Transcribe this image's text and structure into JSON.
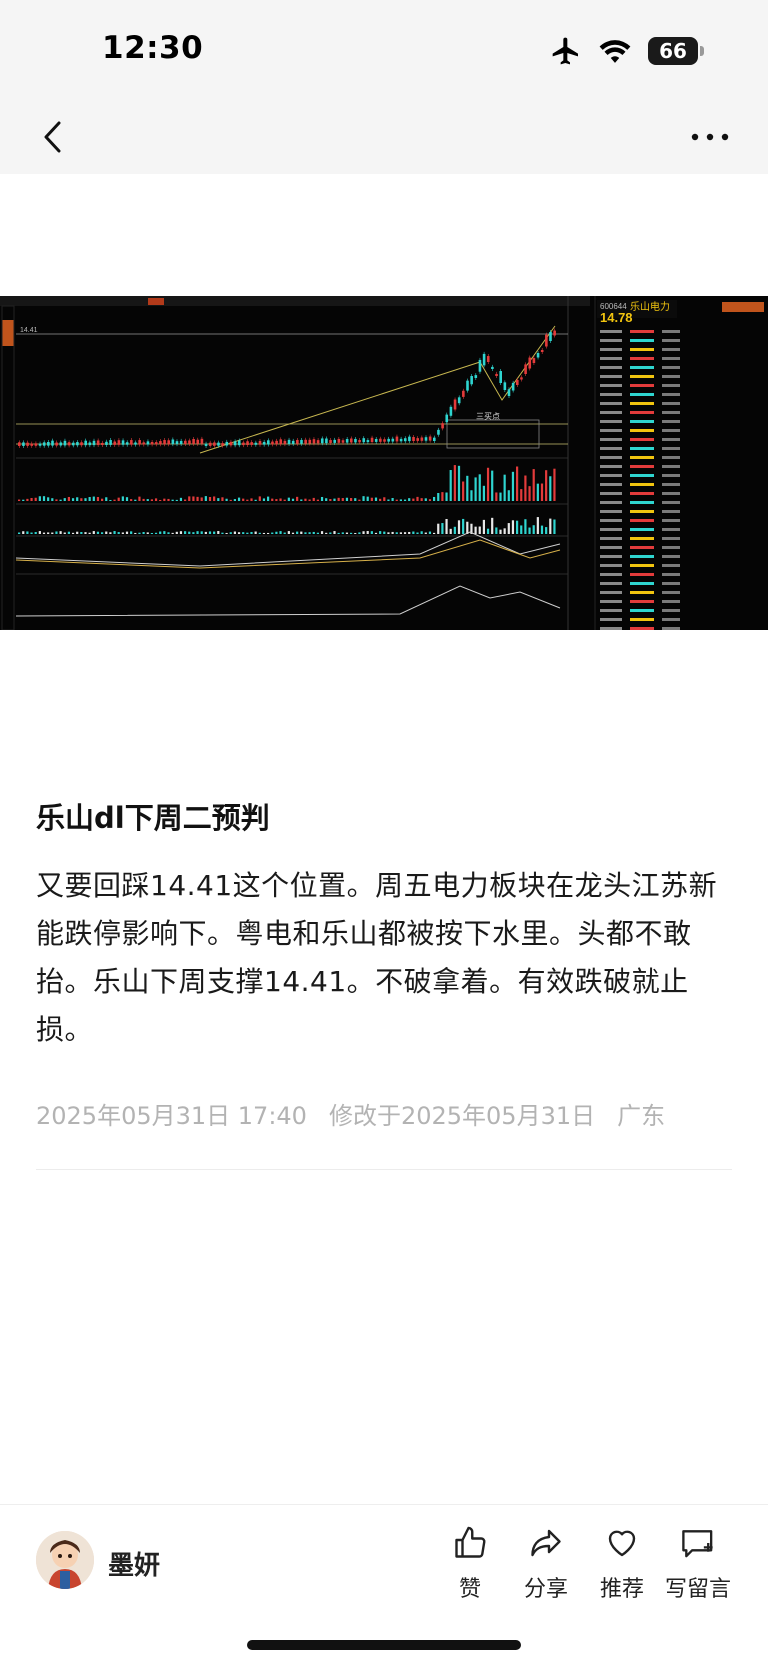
{
  "status_bar": {
    "time": "12:30",
    "battery": "66"
  },
  "nav": {
    "back_icon": "chevron-left-icon",
    "more_icon": "more-horizontal-icon"
  },
  "stock_image": {
    "stock_name": "乐山电力",
    "stock_code": "600644",
    "price": "14.78",
    "level_label": "14.41",
    "annotation": "三买点",
    "colors": {
      "up": "#e33b3b",
      "down": "#2fd5d0",
      "background": "#050505",
      "price": "#f1c40f"
    }
  },
  "post": {
    "title": "乐山dl下周二预判",
    "body": "又要回踩14.41这个位置。周五电力板块在龙头江苏新能跌停影响下。粤电和乐山都被按下水里。头都不敢抬。乐山下周支撑14.41。不破拿着。有效跌破就止损。",
    "published": "2025年05月31日 17:40",
    "modified": "修改于2025年05月31日",
    "location": "广东"
  },
  "bottom_bar": {
    "author": "墨妍",
    "actions": [
      {
        "label": "赞",
        "icon": "thumbs-up-icon"
      },
      {
        "label": "分享",
        "icon": "share-arrow-icon"
      },
      {
        "label": "推荐",
        "icon": "heart-icon"
      },
      {
        "label": "写留言",
        "icon": "comment-add-icon"
      }
    ]
  }
}
